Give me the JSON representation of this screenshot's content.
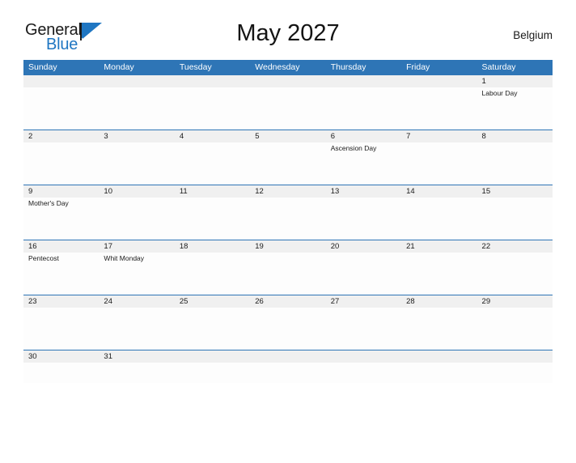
{
  "brand": {
    "word_one": "General",
    "word_two": "Blue",
    "flag_icon": "blue-triangle-flag-icon",
    "accent_color": "#1f76c2"
  },
  "header": {
    "title": "May 2027",
    "country": "Belgium"
  },
  "theme": {
    "header_blue": "#2e75b6",
    "band_gray": "#f0f0f0",
    "cell_white": "#fdfdfd",
    "text_dark": "#1a1a1a"
  },
  "calendar": {
    "weekdays": [
      "Sunday",
      "Monday",
      "Tuesday",
      "Wednesday",
      "Thursday",
      "Friday",
      "Saturday"
    ],
    "weeks": [
      {
        "days": [
          {
            "number": "",
            "events": []
          },
          {
            "number": "",
            "events": []
          },
          {
            "number": "",
            "events": []
          },
          {
            "number": "",
            "events": []
          },
          {
            "number": "",
            "events": []
          },
          {
            "number": "",
            "events": []
          },
          {
            "number": "1",
            "events": [
              "Labour Day"
            ]
          }
        ]
      },
      {
        "days": [
          {
            "number": "2",
            "events": []
          },
          {
            "number": "3",
            "events": []
          },
          {
            "number": "4",
            "events": []
          },
          {
            "number": "5",
            "events": []
          },
          {
            "number": "6",
            "events": [
              "Ascension Day"
            ]
          },
          {
            "number": "7",
            "events": []
          },
          {
            "number": "8",
            "events": []
          }
        ]
      },
      {
        "days": [
          {
            "number": "9",
            "events": [
              "Mother's Day"
            ]
          },
          {
            "number": "10",
            "events": []
          },
          {
            "number": "11",
            "events": []
          },
          {
            "number": "12",
            "events": []
          },
          {
            "number": "13",
            "events": []
          },
          {
            "number": "14",
            "events": []
          },
          {
            "number": "15",
            "events": []
          }
        ]
      },
      {
        "days": [
          {
            "number": "16",
            "events": [
              "Pentecost"
            ]
          },
          {
            "number": "17",
            "events": [
              "Whit Monday"
            ]
          },
          {
            "number": "18",
            "events": []
          },
          {
            "number": "19",
            "events": []
          },
          {
            "number": "20",
            "events": []
          },
          {
            "number": "21",
            "events": []
          },
          {
            "number": "22",
            "events": []
          }
        ]
      },
      {
        "days": [
          {
            "number": "23",
            "events": []
          },
          {
            "number": "24",
            "events": []
          },
          {
            "number": "25",
            "events": []
          },
          {
            "number": "26",
            "events": []
          },
          {
            "number": "27",
            "events": []
          },
          {
            "number": "28",
            "events": []
          },
          {
            "number": "29",
            "events": []
          }
        ]
      },
      {
        "days": [
          {
            "number": "30",
            "events": []
          },
          {
            "number": "31",
            "events": []
          },
          {
            "number": "",
            "events": []
          },
          {
            "number": "",
            "events": []
          },
          {
            "number": "",
            "events": []
          },
          {
            "number": "",
            "events": []
          },
          {
            "number": "",
            "events": []
          }
        ]
      }
    ]
  }
}
